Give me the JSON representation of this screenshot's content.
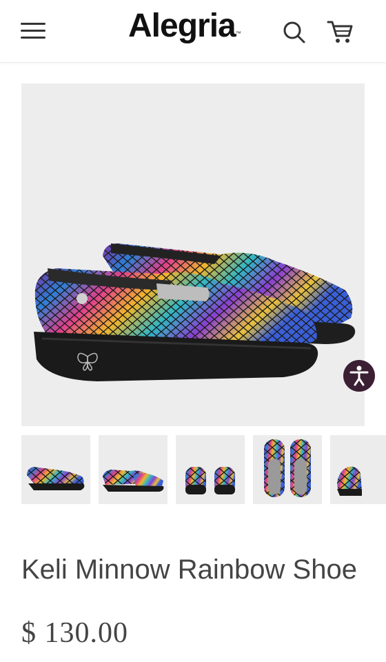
{
  "header": {
    "brand": "Alegria",
    "trademark": "™",
    "menu_icon": "hamburger-menu-icon",
    "search_icon": "search-icon",
    "cart_icon": "shopping-cart-icon"
  },
  "product": {
    "name": "Keli Minnow Rainbow Shoe",
    "price": "$ 130.00",
    "main_image": "multicolor-mosaic-clog-pair-side-view",
    "thumbnails": [
      "pair-angled-view",
      "pair-side-view",
      "pair-heel-view",
      "pair-top-view",
      "single-toe-view"
    ]
  },
  "accessibility_icon": "accessibility-icon",
  "colors": {
    "accessibility_button": "#3b1f33",
    "image_background": "#ededed",
    "text": "#444444"
  }
}
